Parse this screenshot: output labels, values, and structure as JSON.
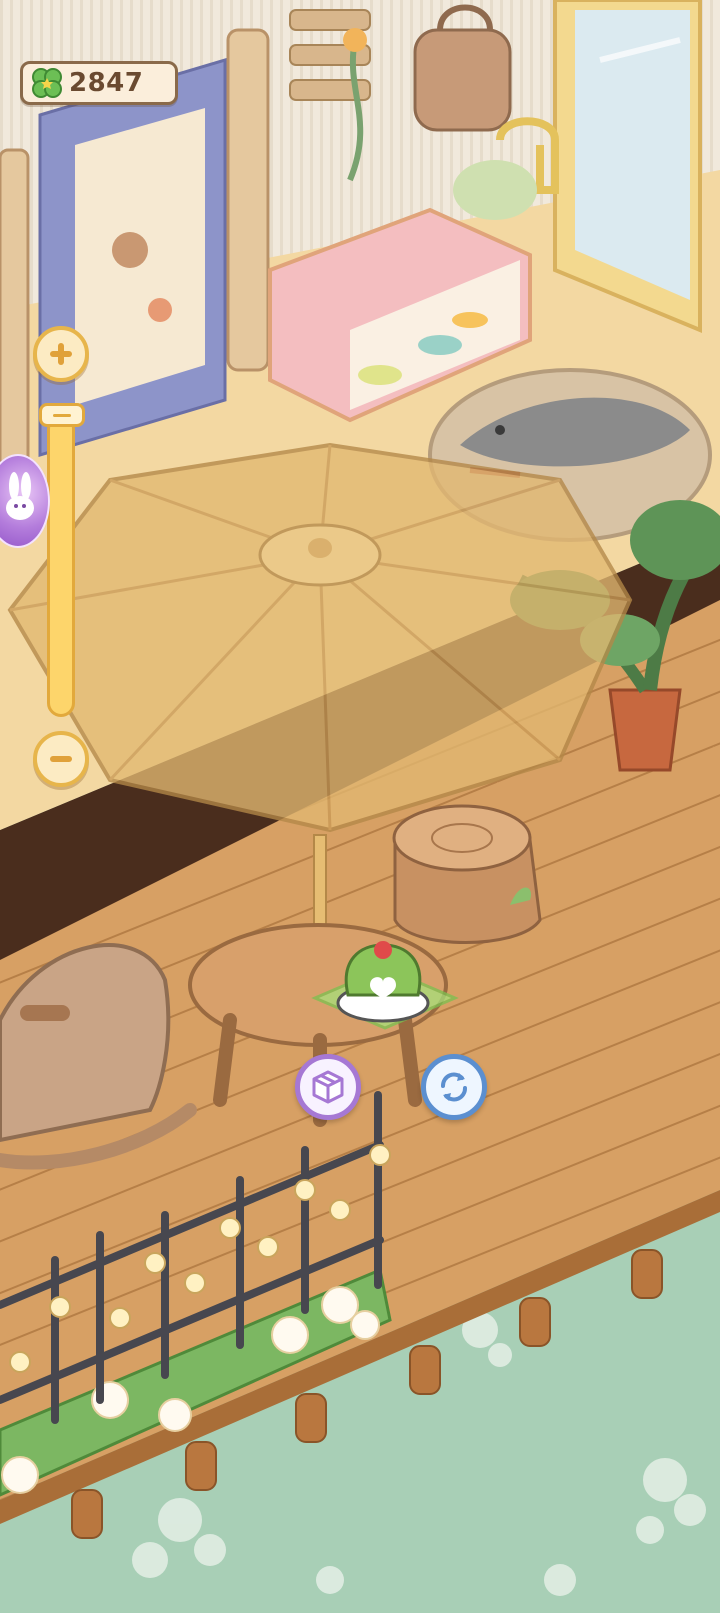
{
  "hud": {
    "currency": {
      "icon": "clover-icon",
      "amount": "2847",
      "color": "#6a4a30"
    },
    "zoom": {
      "plus_icon": "plus-icon",
      "minus_icon": "minus-icon",
      "level": 1.0
    },
    "side_bubble_icon": "bunny-icon"
  },
  "selection": {
    "item": "matcha-cake",
    "actions": [
      {
        "name": "store",
        "icon": "box-icon",
        "color": "#a678d4"
      },
      {
        "name": "rotate",
        "icon": "rotate-icon",
        "color": "#5b8fd0"
      }
    ]
  },
  "scene": {
    "objects": [
      "wall-frame",
      "carrot-rack",
      "hanging-vine",
      "backpack",
      "display-shelf",
      "shark-cushion",
      "parasol",
      "potted-plant",
      "tree-stump",
      "round-table",
      "rocking-horse",
      "iron-fence",
      "flower-planter",
      "wooden-deck"
    ],
    "colors": {
      "grass": "#a8cfb6",
      "deck": "#d9a46a",
      "floor": "#f2d8a0",
      "wall": "#f0e6d6",
      "fence": "#4a4a50"
    }
  }
}
